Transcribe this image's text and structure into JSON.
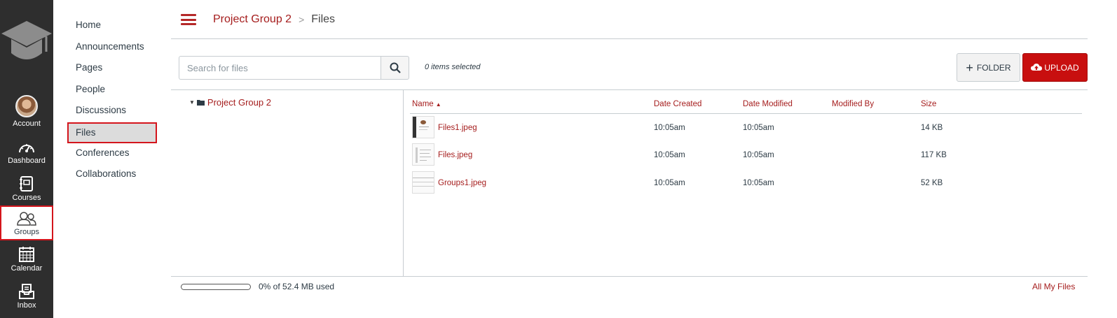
{
  "global_nav": {
    "items": [
      {
        "label": "Account",
        "icon": "avatar"
      },
      {
        "label": "Dashboard",
        "icon": "dashboard-icon"
      },
      {
        "label": "Courses",
        "icon": "courses-icon"
      },
      {
        "label": "Groups",
        "icon": "groups-icon",
        "active": true
      },
      {
        "label": "Calendar",
        "icon": "calendar-icon"
      },
      {
        "label": "Inbox",
        "icon": "inbox-icon"
      }
    ]
  },
  "course_nav": {
    "items": [
      {
        "label": "Home"
      },
      {
        "label": "Announcements"
      },
      {
        "label": "Pages"
      },
      {
        "label": "People"
      },
      {
        "label": "Discussions"
      },
      {
        "label": "Files",
        "active": true
      },
      {
        "label": "Conferences"
      },
      {
        "label": "Collaborations"
      }
    ]
  },
  "breadcrumb": {
    "group": "Project Group 2",
    "separator": ">",
    "current": "Files"
  },
  "toolbar": {
    "search_placeholder": "Search for files",
    "selected_count": "0 items selected",
    "folder_label": "FOLDER",
    "upload_label": "UPLOAD"
  },
  "tree": {
    "root_label": "Project Group 2"
  },
  "table": {
    "headers": {
      "name": "Name",
      "created": "Date Created",
      "modified": "Date Modified",
      "modified_by": "Modified By",
      "size": "Size"
    },
    "rows": [
      {
        "name": "Files1.jpeg",
        "created": "10:05am",
        "modified": "10:05am",
        "modified_by": "",
        "size": "14 KB"
      },
      {
        "name": "Files.jpeg",
        "created": "10:05am",
        "modified": "10:05am",
        "modified_by": "",
        "size": "117 KB"
      },
      {
        "name": "Groups1.jpeg",
        "created": "10:05am",
        "modified": "10:05am",
        "modified_by": "",
        "size": "52 KB"
      }
    ]
  },
  "quota": {
    "used_fraction": 0.0,
    "text": "0% of 52.4 MB used"
  },
  "all_files_link": "All My Files",
  "colors": {
    "nav_bg": "#2e2e2e",
    "accent": "#a51d1d",
    "upload_bg": "#c80f0f",
    "highlight_border": "#d4151c"
  }
}
